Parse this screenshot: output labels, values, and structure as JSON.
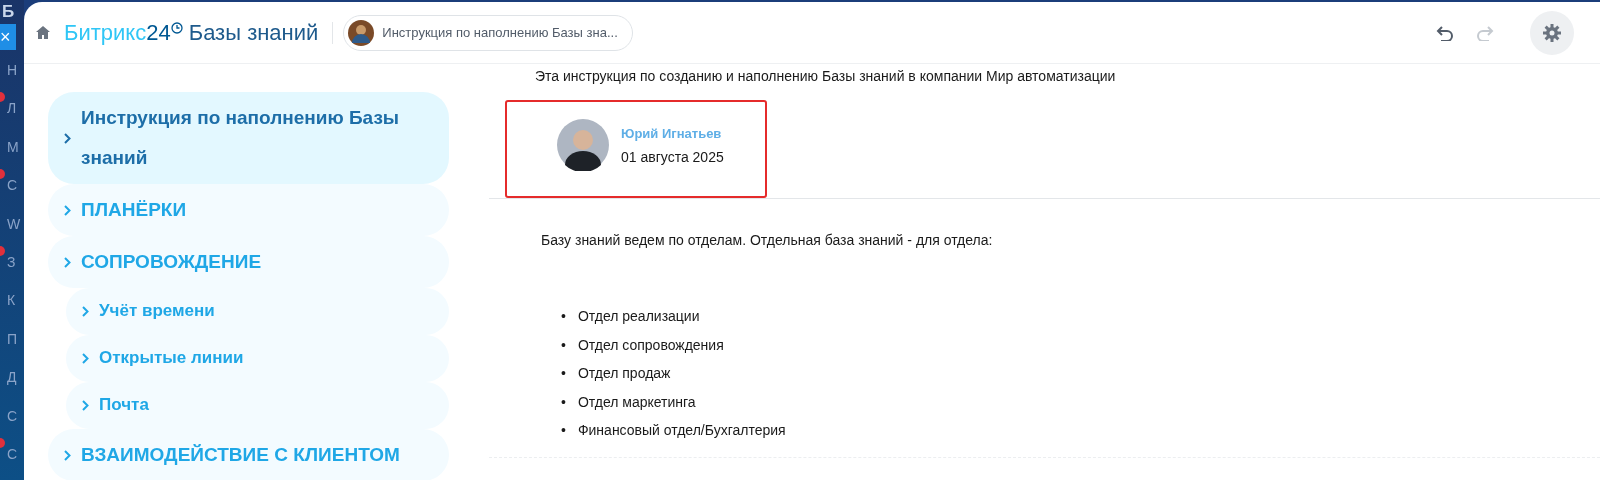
{
  "app_strip": {
    "top_letter": "Б",
    "close": "×",
    "items": [
      {
        "letter": "Н",
        "badge": false
      },
      {
        "letter": "Л",
        "badge": true
      },
      {
        "letter": "М",
        "badge": false
      },
      {
        "letter": "С",
        "badge": true
      },
      {
        "letter": "W",
        "badge": false
      },
      {
        "letter": "З",
        "badge": true
      },
      {
        "letter": "К",
        "badge": false
      },
      {
        "letter": "П",
        "badge": false
      },
      {
        "letter": "Д",
        "badge": false
      },
      {
        "letter": "С",
        "badge": false
      },
      {
        "letter": "С",
        "badge": true
      }
    ]
  },
  "header": {
    "logo": "Битрикс",
    "logo_number": "24",
    "title": "Базы знаний",
    "breadcrumb": "Инструкция по наполнению Базы зна...",
    "undo_disabled": false,
    "redo_disabled": true
  },
  "tree": [
    {
      "label": "Инструкция по наполнению Базы знаний",
      "selected": true
    },
    {
      "label": "ПЛАНЁРКИ",
      "selected": false
    },
    {
      "label": "СОПРОВОЖДЕНИЕ",
      "selected": false,
      "children": [
        {
          "label": "Учёт времени",
          "selected": false
        },
        {
          "label": "Открытые линии",
          "selected": false
        },
        {
          "label": "Почта",
          "selected": false
        }
      ]
    },
    {
      "label": "ВЗАИМОДЕЙСТВИЕ С КЛИЕНТОМ",
      "selected": false
    }
  ],
  "article": {
    "intro": "Эта инструкция по созданию и наполнению Базы знаний в компании Мир автоматизации",
    "author": {
      "name": "Юрий Игнатьев",
      "date": "01 августа 2025",
      "highlighted": true
    },
    "lead": "Базу знаний ведем по отделам. Отдельная база знаний - для отдела:",
    "list": [
      {
        "marker": "•",
        "text": "Отдел реализации"
      },
      {
        "marker": "•",
        "text": "Отдел сопровождения"
      },
      {
        "marker": "•",
        "text": "Отдел продаж"
      },
      {
        "marker": "•",
        "text": "Отдел маркетинга"
      },
      {
        "marker": "•",
        "text": "Финансовый отдел/Бухгалтерия"
      }
    ]
  }
}
